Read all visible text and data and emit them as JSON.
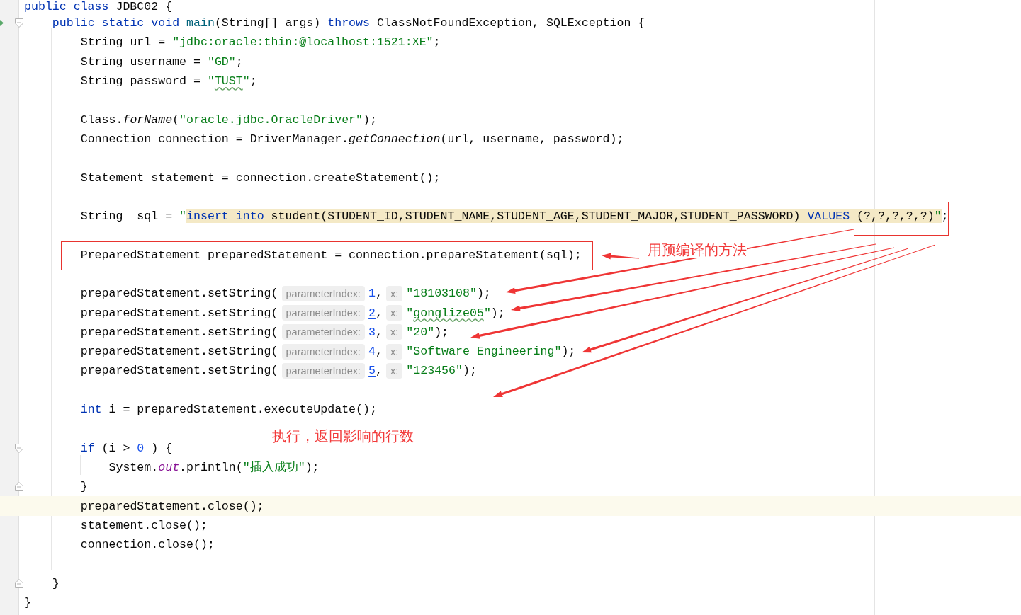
{
  "editor": {
    "lines": [
      {
        "current": false,
        "tokens": [
          {
            "kind": "keyword",
            "text": "public class "
          },
          {
            "kind": "plain",
            "text": "JDBC02 {"
          }
        ]
      },
      {
        "run_icon": true,
        "fold_start": true,
        "current": false,
        "tokens": [
          {
            "kind": "keyword",
            "text": "    public static void "
          },
          {
            "kind": "method",
            "text": "main"
          },
          {
            "kind": "plain",
            "text": "(String[] args) "
          },
          {
            "kind": "keyword",
            "text": "throws "
          },
          {
            "kind": "plain",
            "text": "ClassNotFoundException, SQLException {"
          }
        ]
      },
      {
        "current": false,
        "tokens": [
          {
            "kind": "plain",
            "text": "        String url = "
          },
          {
            "kind": "string",
            "text": "\"jdbc:oracle:thin:@localhost:1521:XE\""
          },
          {
            "kind": "plain",
            "text": ";"
          }
        ]
      },
      {
        "current": false,
        "tokens": [
          {
            "kind": "plain",
            "text": "        String username = "
          },
          {
            "kind": "string",
            "text": "\"GD\""
          },
          {
            "kind": "plain",
            "text": ";"
          }
        ]
      },
      {
        "current": false,
        "tokens": [
          {
            "kind": "plain",
            "text": "        String password = "
          },
          {
            "kind": "string",
            "text": "\""
          },
          {
            "kind": "string_typo",
            "text": "TUST"
          },
          {
            "kind": "string",
            "text": "\""
          },
          {
            "kind": "plain",
            "text": ";"
          }
        ]
      },
      {
        "current": false
      },
      {
        "current": false,
        "tokens": [
          {
            "kind": "plain",
            "text": "        Class."
          },
          {
            "kind": "static_method",
            "text": "forName"
          },
          {
            "kind": "plain",
            "text": "("
          },
          {
            "kind": "string",
            "text": "\"oracle.jdbc.OracleDriver\""
          },
          {
            "kind": "plain",
            "text": ");"
          }
        ]
      },
      {
        "current": false,
        "tokens": [
          {
            "kind": "plain",
            "text": "        Connection connection = DriverManager."
          },
          {
            "kind": "static_method",
            "text": "getConnection"
          },
          {
            "kind": "plain",
            "text": "(url, username, password);"
          }
        ]
      },
      {
        "current": false
      },
      {
        "current": false,
        "tokens": [
          {
            "kind": "plain",
            "text": "        Statement statement = connection.createStatement();"
          }
        ]
      },
      {
        "current": false
      },
      {
        "current": false,
        "tokens": [
          {
            "kind": "plain",
            "text": "        String  sql = "
          },
          {
            "kind": "string",
            "text": "\""
          },
          {
            "kind": "sql_keyword",
            "text": "insert into "
          },
          {
            "kind": "sql_text",
            "text": "student(STUDENT_ID,STUDENT_NAME,STUDENT_AGE,STUDENT_MAJOR,STUDENT_PASSWORD) "
          },
          {
            "kind": "sql_keyword",
            "text": "VALUES "
          },
          {
            "kind": "sql_text",
            "text": "(?,?,?,?,?)"
          },
          {
            "kind": "sql_string",
            "text": "\""
          },
          {
            "kind": "plain",
            "text": ";"
          }
        ]
      },
      {
        "current": false
      },
      {
        "current": false,
        "tokens": [
          {
            "kind": "plain",
            "text": "        PreparedStatement preparedStatement = connection.prepareStatement(sql);"
          }
        ]
      },
      {
        "current": false
      },
      {
        "current": false,
        "tokens": [
          {
            "kind": "plain",
            "text": "        preparedStatement.setString("
          },
          {
            "kind": "hint",
            "text": "parameterIndex:"
          },
          {
            "kind": "index",
            "text": "1"
          },
          {
            "kind": "plain",
            "text": ","
          },
          {
            "kind": "hint",
            "text": "x:"
          },
          {
            "kind": "string",
            "text": "\"18103108\""
          },
          {
            "kind": "plain",
            "text": ");"
          }
        ]
      },
      {
        "current": false,
        "tokens": [
          {
            "kind": "plain",
            "text": "        preparedStatement.setString("
          },
          {
            "kind": "hint",
            "text": "parameterIndex:"
          },
          {
            "kind": "index",
            "text": "2"
          },
          {
            "kind": "plain",
            "text": ","
          },
          {
            "kind": "hint",
            "text": "x:"
          },
          {
            "kind": "string",
            "text": "\""
          },
          {
            "kind": "string_typo",
            "text": "gonglize05"
          },
          {
            "kind": "string",
            "text": "\""
          },
          {
            "kind": "plain",
            "text": ");"
          }
        ]
      },
      {
        "current": false,
        "tokens": [
          {
            "kind": "plain",
            "text": "        preparedStatement.setString("
          },
          {
            "kind": "hint",
            "text": "parameterIndex:"
          },
          {
            "kind": "index",
            "text": "3"
          },
          {
            "kind": "plain",
            "text": ","
          },
          {
            "kind": "hint",
            "text": "x:"
          },
          {
            "kind": "string",
            "text": "\"20\""
          },
          {
            "kind": "plain",
            "text": ");"
          }
        ]
      },
      {
        "current": false,
        "tokens": [
          {
            "kind": "plain",
            "text": "        preparedStatement.setString("
          },
          {
            "kind": "hint",
            "text": "parameterIndex:"
          },
          {
            "kind": "index",
            "text": "4"
          },
          {
            "kind": "plain",
            "text": ","
          },
          {
            "kind": "hint",
            "text": "x:"
          },
          {
            "kind": "string",
            "text": "\"Software Engineering\""
          },
          {
            "kind": "plain",
            "text": ");"
          }
        ]
      },
      {
        "current": false,
        "tokens": [
          {
            "kind": "plain",
            "text": "        preparedStatement.setString("
          },
          {
            "kind": "hint",
            "text": "parameterIndex:"
          },
          {
            "kind": "index",
            "text": "5"
          },
          {
            "kind": "plain",
            "text": ","
          },
          {
            "kind": "hint",
            "text": "x:"
          },
          {
            "kind": "string",
            "text": "\"123456\""
          },
          {
            "kind": "plain",
            "text": ");"
          }
        ]
      },
      {
        "current": false
      },
      {
        "current": false,
        "tokens": [
          {
            "kind": "keyword",
            "text": "        int "
          },
          {
            "kind": "plain",
            "text": "i = preparedStatement.executeUpdate();"
          }
        ]
      },
      {
        "current": false
      },
      {
        "fold_start": true,
        "current": false,
        "tokens": [
          {
            "kind": "keyword",
            "text": "        if "
          },
          {
            "kind": "plain",
            "text": "(i > "
          },
          {
            "kind": "number",
            "text": "0"
          },
          {
            "kind": "plain",
            "text": " ) {"
          }
        ]
      },
      {
        "current": false,
        "tokens": [
          {
            "kind": "plain",
            "text": "            System."
          },
          {
            "kind": "field",
            "text": "out"
          },
          {
            "kind": "plain",
            "text": ".println("
          },
          {
            "kind": "string",
            "text": "\"插入成功\""
          },
          {
            "kind": "plain",
            "text": ");"
          }
        ]
      },
      {
        "fold_end": true,
        "current": false,
        "tokens": [
          {
            "kind": "plain",
            "text": "        }"
          }
        ]
      },
      {
        "current": true,
        "tokens": [
          {
            "kind": "plain",
            "text": "        preparedStatement.close();"
          }
        ]
      },
      {
        "current": false,
        "tokens": [
          {
            "kind": "plain",
            "text": "        statement.close();"
          }
        ]
      },
      {
        "current": false,
        "tokens": [
          {
            "kind": "plain",
            "text": "        connection.close();"
          }
        ]
      },
      {
        "current": false
      },
      {
        "fold_end": true,
        "current": false,
        "tokens": [
          {
            "kind": "plain",
            "text": "    }"
          }
        ]
      },
      {
        "current": false,
        "tokens": [
          {
            "kind": "plain",
            "text": "}"
          }
        ]
      }
    ]
  },
  "callouts": [
    {
      "text": "用预编译的方法"
    },
    {
      "text": "执行，返回影响的行数"
    }
  ]
}
